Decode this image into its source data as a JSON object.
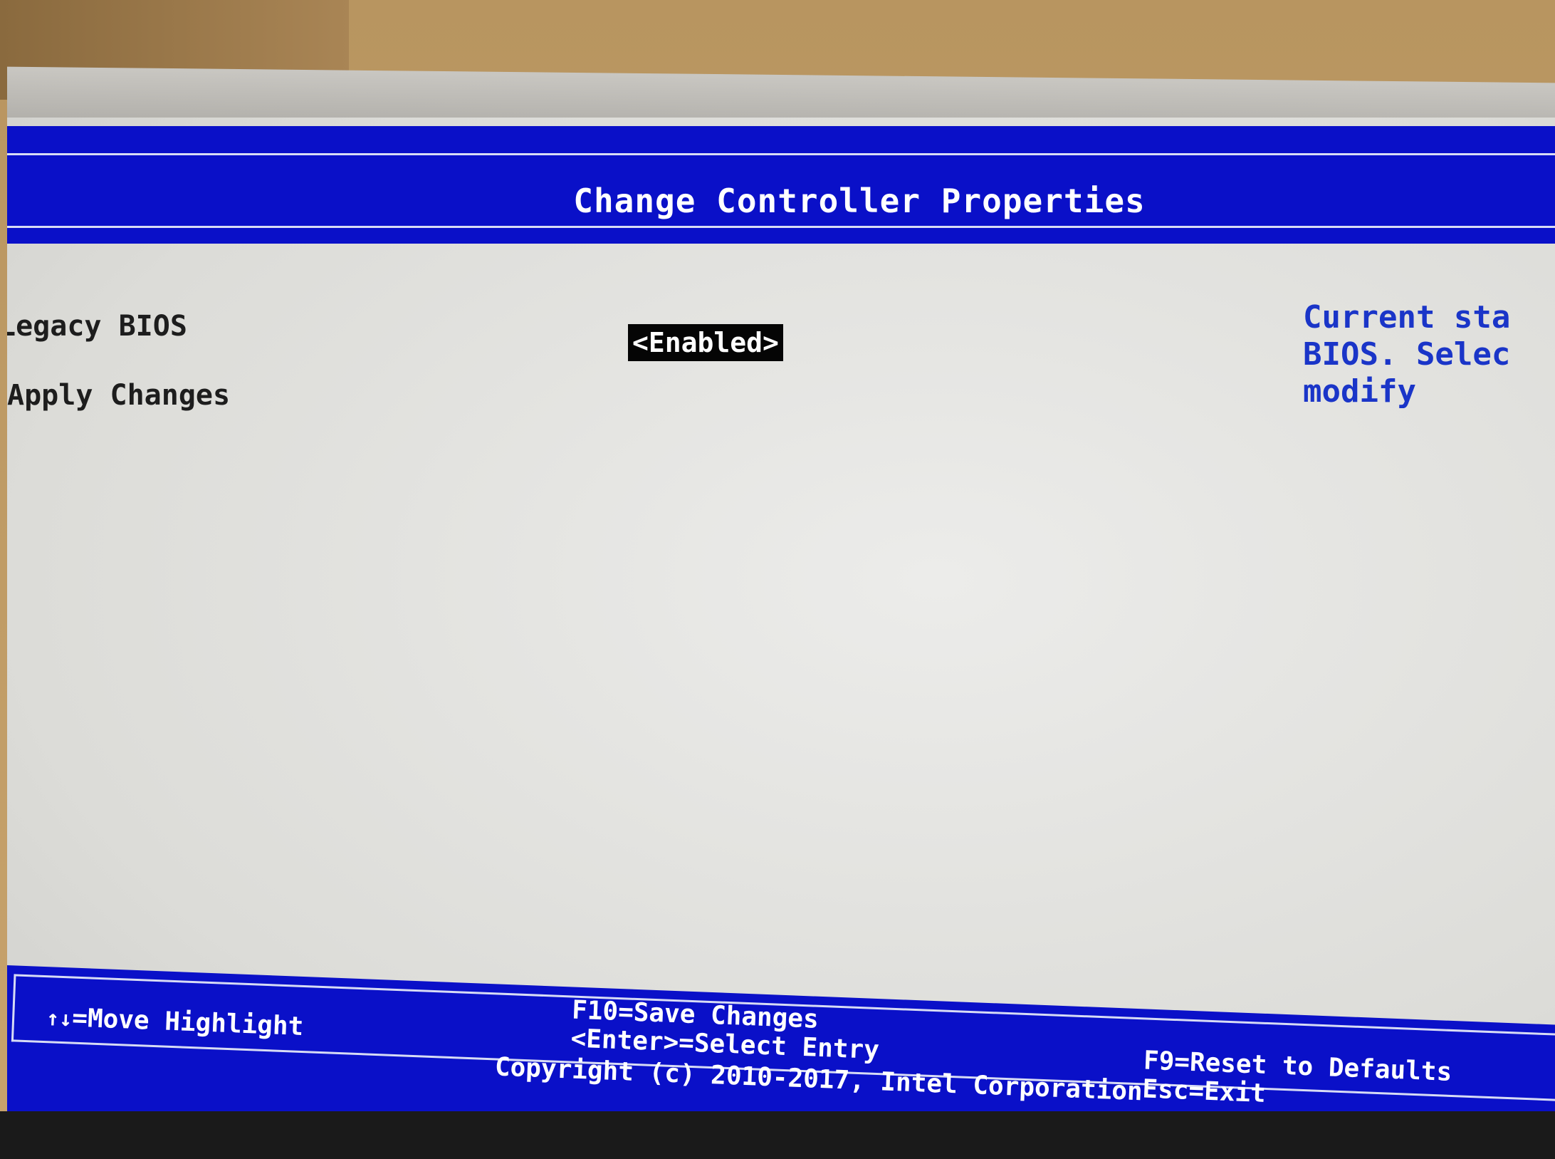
{
  "header": {
    "title": "Change Controller Properties"
  },
  "settings": [
    {
      "label": "Legacy BIOS",
      "value": "<Enabled>"
    },
    {
      "label": "Apply Changes"
    }
  ],
  "help": {
    "text": "Current sta\nBIOS. Selec\nmodify"
  },
  "footer": {
    "move": "=Move Highlight",
    "move_icon": "↑↓",
    "save": "F10=Save Changes",
    "select": "<Enter>=Select Entry",
    "reset": "F9=Reset to Defaults",
    "exit": "Esc=Exit",
    "copyright": "Copyright (c) 2010-2017, Intel Corporation"
  },
  "colors": {
    "header_bg": "#0a10c8",
    "screen_bg": "#e4e4e2",
    "help_text": "#1a35c8",
    "highlight_bg": "#050505"
  }
}
